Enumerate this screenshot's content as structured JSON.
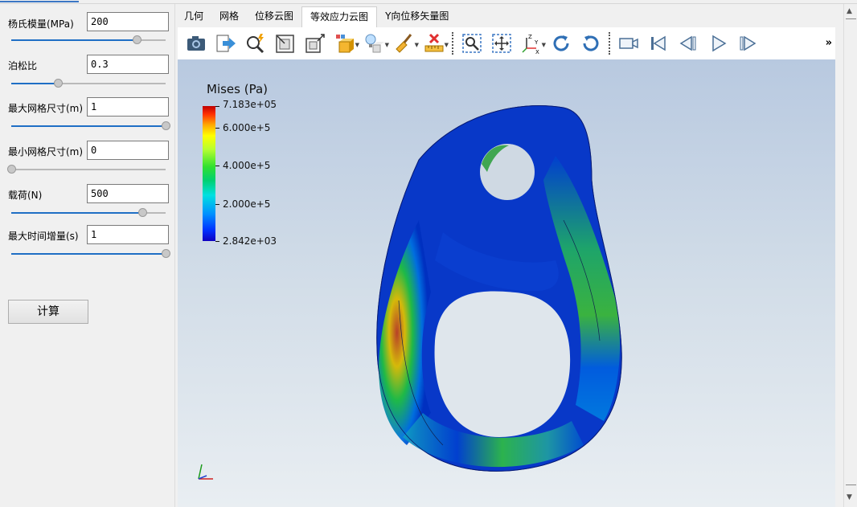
{
  "parameters": [
    {
      "label": "杨氏模量(MPa)",
      "value": "200",
      "slider": 0.81
    },
    {
      "label": "泊松比",
      "value": "0.3",
      "slider": 0.3
    },
    {
      "label": "最大网格尺寸(m)",
      "value": "1",
      "slider": 1.0
    },
    {
      "label": "最小网格尺寸(m)",
      "value": "0",
      "slider": 0.0
    },
    {
      "label": "载荷(N)",
      "value": "500",
      "slider": 0.85
    },
    {
      "label": "最大时间增量(s)",
      "value": "1",
      "slider": 1.0
    }
  ],
  "calc_button": "计算",
  "tabs": [
    "几何",
    "网格",
    "位移云图",
    "等效应力云图",
    "Y向位移矢量图"
  ],
  "active_tab_index": 3,
  "toolbar_more": "»",
  "legend": {
    "title": "Mises (Pa)",
    "ticks": [
      "7.183e+05",
      "6.000e+5",
      "4.000e+5",
      "2.000e+5",
      "2.842e+03"
    ]
  },
  "axes": {
    "x": "X",
    "y": "Y",
    "z": "Z"
  },
  "colors": {
    "accent": "#1f6fc5",
    "stress_high": "#c00000",
    "stress_low": "#1000c0"
  }
}
